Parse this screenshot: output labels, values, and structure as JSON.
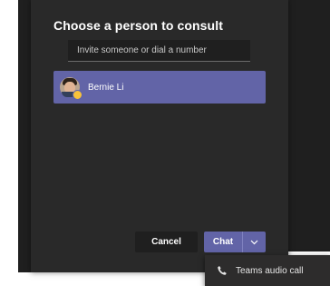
{
  "dialog": {
    "title": "Choose a person to consult",
    "search": {
      "placeholder": "Invite someone or dial a number",
      "value": ""
    },
    "selected_person": {
      "name": "Bernie Li",
      "presence": "away"
    },
    "buttons": {
      "cancel_label": "Cancel",
      "chat_label": "Chat"
    }
  },
  "dropdown_menu": {
    "items": [
      {
        "label": "Teams audio call",
        "icon": "phone-icon"
      }
    ]
  },
  "colors": {
    "accent": "#6264a7",
    "dialog_bg": "#292929",
    "presence_away": "#f8c23a"
  }
}
